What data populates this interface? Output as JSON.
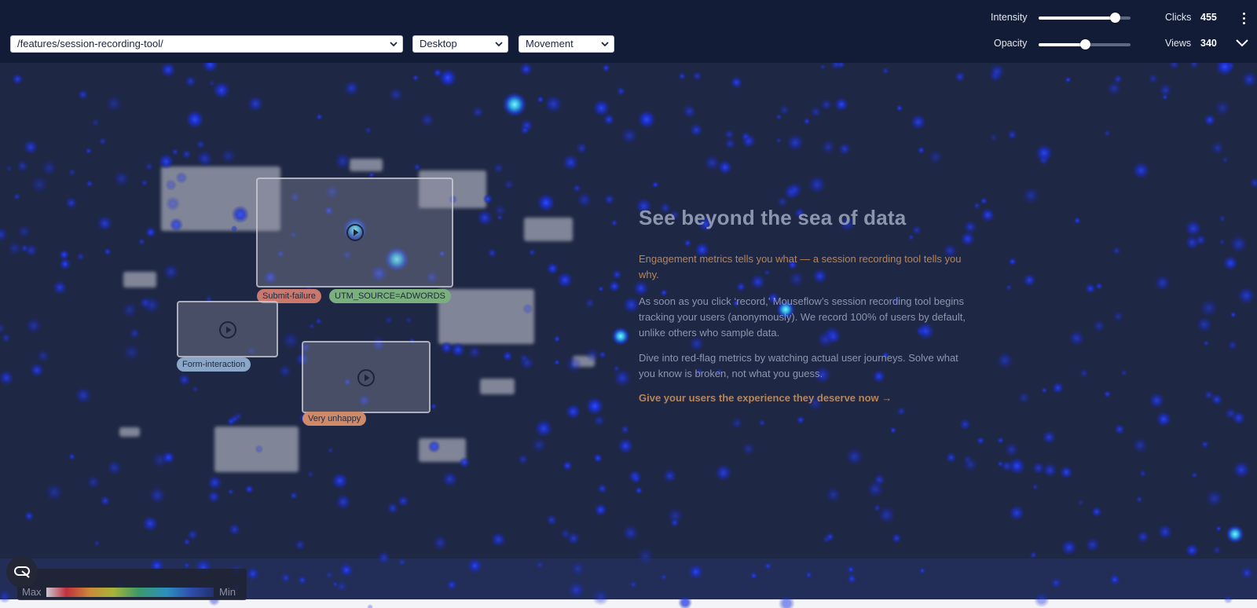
{
  "toolbar": {
    "url_select": "/features/session-recording-tool/",
    "device_select": "Desktop",
    "mode_select": "Movement",
    "intensity_label": "Intensity",
    "intensity_level": 0.83,
    "opacity_label": "Opacity",
    "opacity_level": 0.5,
    "clicks_label": "Clicks",
    "clicks_value": "455",
    "views_label": "Views",
    "views_value": "340"
  },
  "hero": {
    "title": "See beyond the sea of data",
    "p1": "Engagement metrics tells you what — a session recording tool tells you why.",
    "p2": "As soon as you click ‘record,’ Mouseflow’s session recording tool begins tracking your users (anonymously). We record 100% of users by default, unlike others who sample data.",
    "p3": "Dive into red-flag metrics by watching actual user journeys. Solve what you know is broken, not what you guess.",
    "cta": "Give your users the experience they deserve now →"
  },
  "tags": {
    "submit_failure": "Submit-failure",
    "utm_source": "UTM_SOURCE=ADWORDS",
    "form_interaction": "Form-interaction",
    "very_unhappy": "Very unhappy"
  },
  "legend": {
    "max_label": "Max",
    "min_label": "Min"
  },
  "colors": {
    "toolbar_bg": "#131c36",
    "page_bg": "#1e2744",
    "hotspot": "#1f3fff",
    "hotspot_hot": "#36c8e8",
    "accent": "#b7855a"
  },
  "icons": {
    "play": "play-circle-icon",
    "menu": "kebab-menu-icon",
    "collapse": "chevron-down-icon",
    "legend": "heatmap-legend-icon"
  }
}
